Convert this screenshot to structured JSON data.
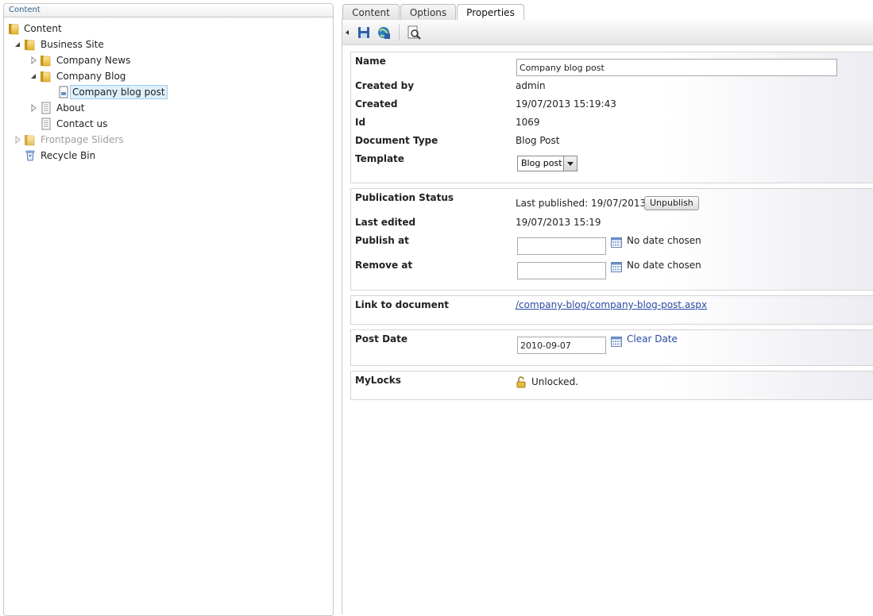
{
  "tree": {
    "header": "Content",
    "nodes": [
      {
        "label": "Content"
      },
      {
        "label": "Business Site"
      },
      {
        "label": "Company News"
      },
      {
        "label": "Company Blog"
      },
      {
        "label": "Company blog post"
      },
      {
        "label": "About"
      },
      {
        "label": "Contact us"
      },
      {
        "label": "Frontpage Sliders"
      },
      {
        "label": "Recycle Bin"
      }
    ]
  },
  "tabs": [
    "Content",
    "Options",
    "Properties"
  ],
  "properties": {
    "name_label": "Name",
    "name_value": "Company blog post",
    "created_by_label": "Created by",
    "created_by_value": "admin",
    "created_label": "Created",
    "created_value": "19/07/2013 15:19:43",
    "id_label": "Id",
    "id_value": "1069",
    "doctype_label": "Document Type",
    "doctype_value": "Blog Post",
    "template_label": "Template",
    "template_value": "Blog post"
  },
  "publication": {
    "status_label": "Publication Status",
    "last_published": "Last published: 19/07/2013",
    "unpublish_button": "Unpublish",
    "last_edited_label": "Last edited",
    "last_edited_value": "19/07/2013 15:19",
    "publish_at_label": "Publish at",
    "publish_at_value": "",
    "publish_at_status": "No date chosen",
    "remove_at_label": "Remove at",
    "remove_at_value": "",
    "remove_at_status": "No date chosen"
  },
  "link": {
    "label": "Link to document",
    "url": "/company-blog/company-blog-post.aspx"
  },
  "post_date": {
    "label": "Post Date",
    "value": "2010-09-07",
    "clear_label": "Clear Date"
  },
  "locks": {
    "label": "MyLocks",
    "status": "Unlocked."
  },
  "colors": {
    "link": "#2a4aa5",
    "selected_bg": "#dff0fb",
    "folder": "#e8b830"
  }
}
